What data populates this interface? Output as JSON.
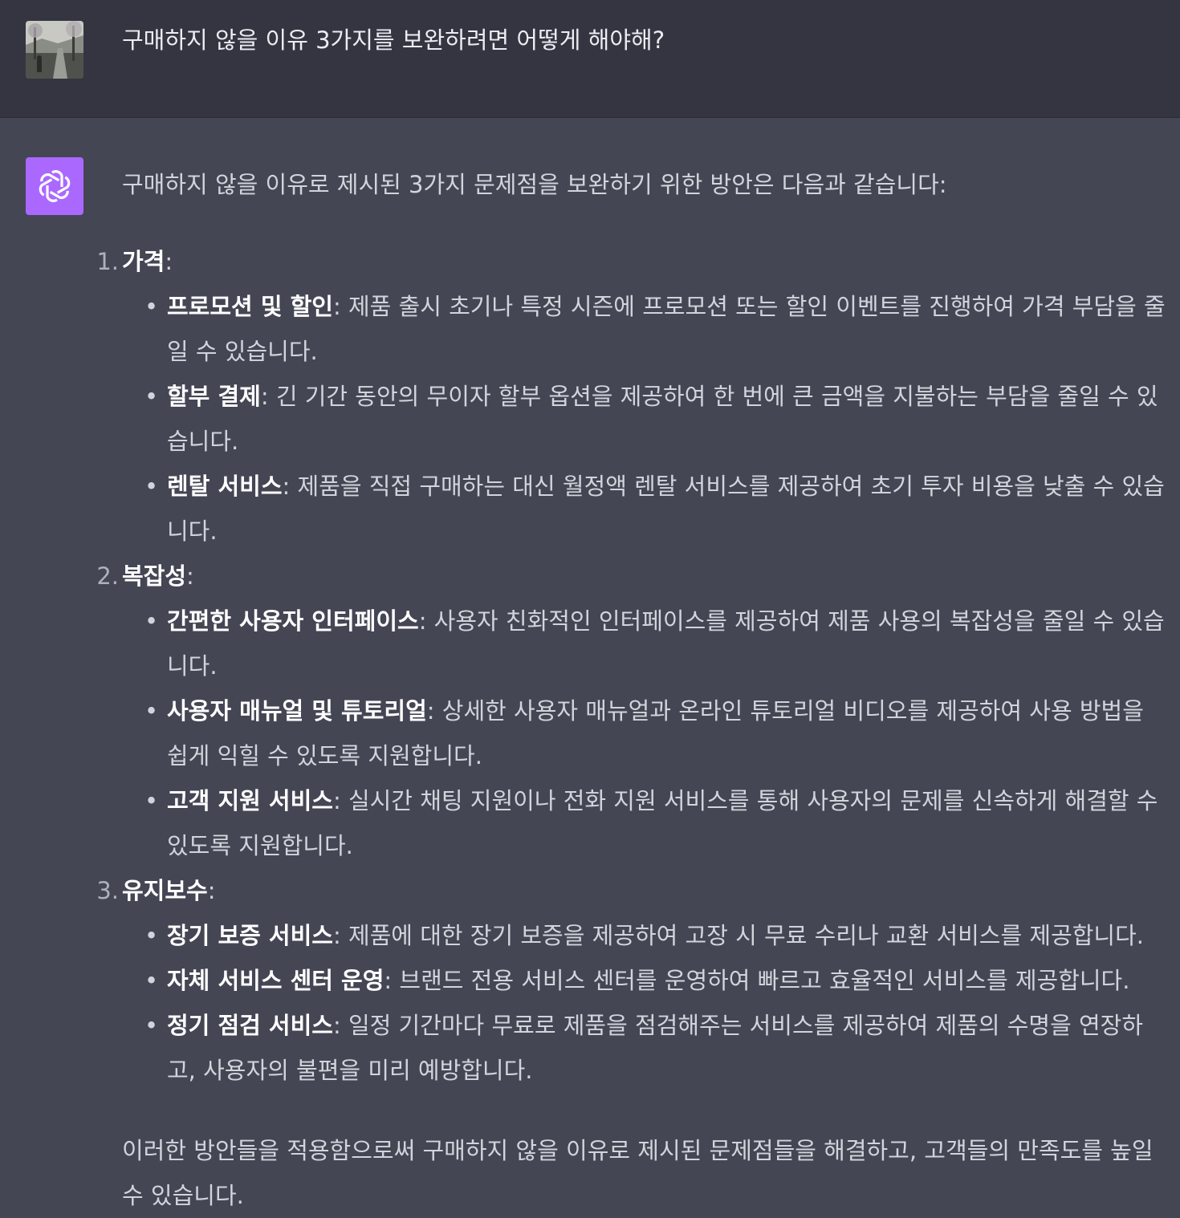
{
  "user": {
    "message": "구매하지 않을 이유 3가지를 보완하려면 어떻게 해야해?",
    "avatar_icon": "user-photo-avatar"
  },
  "assistant": {
    "avatar_icon": "openai-logo-icon",
    "avatar_color": "#ab68ff",
    "intro": "구매하지 않을 이유로 제시된 3가지 문제점을 보완하기 위한 방안은 다음과 같습니다:",
    "sections": [
      {
        "number": "1.",
        "heading": "가격",
        "items": [
          {
            "term": "프로모션 및 할인",
            "text": ": 제품 출시 초기나 특정 시즌에 프로모션 또는 할인 이벤트를 진행하여 가격 부담을 줄일 수 있습니다."
          },
          {
            "term": "할부 결제",
            "text": ": 긴 기간 동안의 무이자 할부 옵션을 제공하여 한 번에 큰 금액을 지불하는 부담을 줄일 수 있습니다."
          },
          {
            "term": "렌탈 서비스",
            "text": ": 제품을 직접 구매하는 대신 월정액 렌탈 서비스를 제공하여 초기 투자 비용을 낮출 수 있습니다."
          }
        ]
      },
      {
        "number": "2.",
        "heading": "복잡성",
        "items": [
          {
            "term": "간편한 사용자 인터페이스",
            "text": ": 사용자 친화적인 인터페이스를 제공하여 제품 사용의 복잡성을 줄일 수 있습니다."
          },
          {
            "term": "사용자 매뉴얼 및 튜토리얼",
            "text": ": 상세한 사용자 매뉴얼과 온라인 튜토리얼 비디오를 제공하여 사용 방법을 쉽게 익힐 수 있도록 지원합니다."
          },
          {
            "term": "고객 지원 서비스",
            "text": ": 실시간 채팅 지원이나 전화 지원 서비스를 통해 사용자의 문제를 신속하게 해결할 수 있도록 지원합니다."
          }
        ]
      },
      {
        "number": "3.",
        "heading": "유지보수",
        "items": [
          {
            "term": "장기 보증 서비스",
            "text": ": 제품에 대한 장기 보증을 제공하여 고장 시 무료 수리나 교환 서비스를 제공합니다."
          },
          {
            "term": "자체 서비스 센터 운영",
            "text": ": 브랜드 전용 서비스 센터를 운영하여 빠르고 효율적인 서비스를 제공합니다."
          },
          {
            "term": "정기 점검 서비스",
            "text": ": 일정 기간마다 무료로 제품을 점검해주는 서비스를 제공하여 제품의 수명을 연장하고, 사용자의 불편을 미리 예방합니다."
          }
        ]
      }
    ],
    "conclusion": "이러한 방안들을 적용함으로써 구매하지 않을 이유로 제시된 문제점들을 해결하고, 고객들의 만족도를 높일 수 있습니다."
  }
}
